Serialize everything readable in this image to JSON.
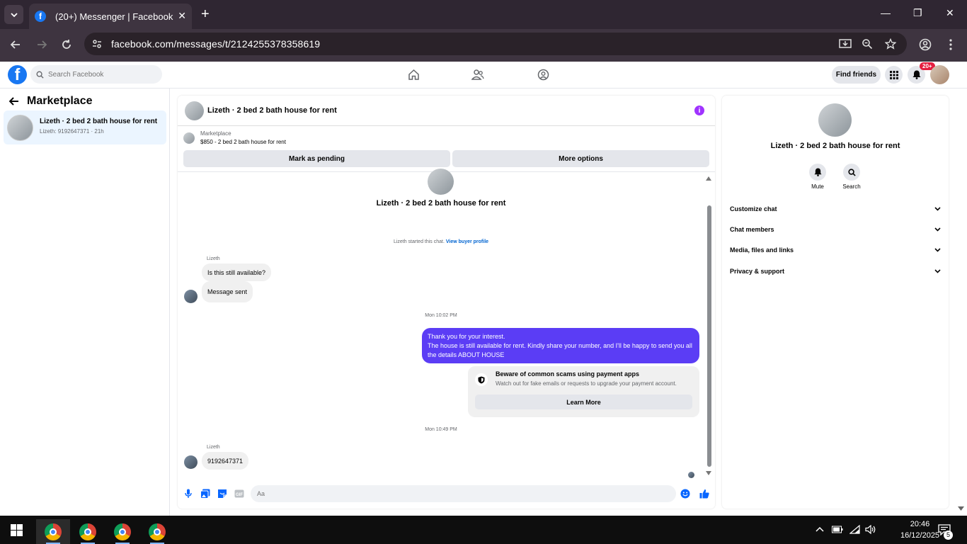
{
  "browser": {
    "tab_title": "(20+) Messenger | Facebook",
    "url": "facebook.com/messages/t/2124255378358619"
  },
  "fb_header": {
    "search_placeholder": "Search Facebook",
    "find_friends": "Find friends",
    "notif_badge": "20+"
  },
  "left": {
    "title": "Marketplace",
    "conversation": {
      "name": "Lizeth · 2 bed 2 bath house for rent",
      "subtitle": "Lizeth: 9192647371 · 21h"
    }
  },
  "chat": {
    "header_name": "Lizeth · 2 bed 2 bath house for rent",
    "marketplace_label": "Marketplace",
    "listing": "$850 - 2 bed 2 bath house for rent",
    "mark_pending": "Mark as pending",
    "more_options": "More options",
    "hero_name": "Lizeth · 2 bed 2 bath house for rent",
    "started_text": "Lizeth started this chat.",
    "view_profile": "View buyer profile",
    "sender1": "Lizeth",
    "msg1": "Is this still available?",
    "msg2": "Message sent",
    "time1": "Mon 10:02 PM",
    "out_line1": "Thank you for your interest.",
    "out_line2": "The house is still available for rent. Kindly share your number, and I'll be happy to send you all the details ABOUT HOUSE",
    "scam_title": "Beware of common scams using payment apps",
    "scam_sub": "Watch out for fake emails or requests to upgrade your payment account.",
    "learn_more": "Learn More",
    "time2": "Mon 10:49 PM",
    "sender2": "Lizeth",
    "msg3": "9192647371",
    "composer_placeholder": "Aa",
    "accent_color": "#5b3df5"
  },
  "right": {
    "name": "Lizeth · 2 bed 2 bath house for rent",
    "mute": "Mute",
    "search": "Search",
    "sections": [
      "Customize chat",
      "Chat members",
      "Media, files and links",
      "Privacy & support"
    ]
  },
  "taskbar": {
    "time": "20:46",
    "date": "16/12/2025",
    "notif_count": "5"
  }
}
